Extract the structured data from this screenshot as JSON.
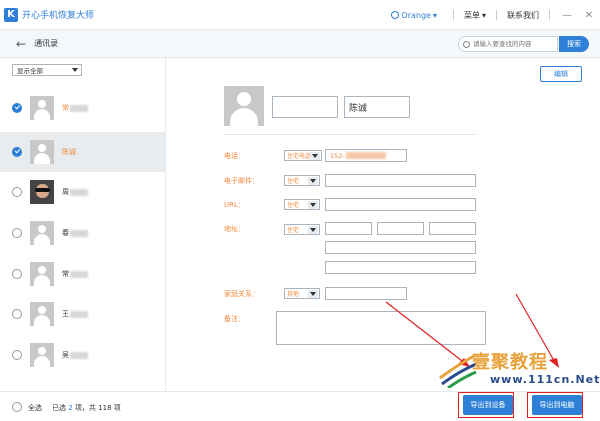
{
  "app": {
    "logo_letter": "K",
    "title": "开心手机恢复大师"
  },
  "titlebar": {
    "user": "Orange",
    "menu": "菜单",
    "contact_us": "联系我们",
    "minimize": "—",
    "close": "✕"
  },
  "subheader": {
    "back": "←",
    "title": "通讯录",
    "search_placeholder": "请输入要查找的内容",
    "search_button": "搜索"
  },
  "filter": {
    "selected": "显示全部"
  },
  "contacts": [
    {
      "name": "常",
      "checked": true,
      "orange": true
    },
    {
      "name": "陈诚",
      "checked": true,
      "orange": true
    },
    {
      "name": "周",
      "checked": false,
      "orange": false
    },
    {
      "name": "春",
      "checked": false,
      "orange": false
    },
    {
      "name": "常",
      "checked": false,
      "orange": false
    },
    {
      "name": "王",
      "checked": false,
      "orange": false
    },
    {
      "name": "吴",
      "checked": false,
      "orange": false
    }
  ],
  "detail": {
    "edit": "编辑",
    "first_name": "",
    "last_name": "陈诚",
    "labels": {
      "phone": "电话：",
      "email": "电子邮件：",
      "url": "URL：",
      "address": "地址：",
      "family": "家庭关系：",
      "note": "备注："
    },
    "types": {
      "phone": "住宅电话",
      "email": "住宅",
      "url": "住宅",
      "address": "住宅",
      "family": "其他"
    },
    "phone_value": "152-"
  },
  "bottom": {
    "select_all": "全选",
    "selected_prefix": "已选",
    "selected_count": "2",
    "selected_mid": "项，共",
    "total": "118",
    "selected_suffix": "项",
    "export_device": "导出到设备",
    "export_computer": "导出到电脑"
  },
  "watermark": {
    "line1": "壹聚教程",
    "line2": "www.111cn.Net"
  },
  "colors": {
    "accent": "#2d7fd8",
    "highlight": "#f08a3c",
    "frame": "#e02020"
  }
}
